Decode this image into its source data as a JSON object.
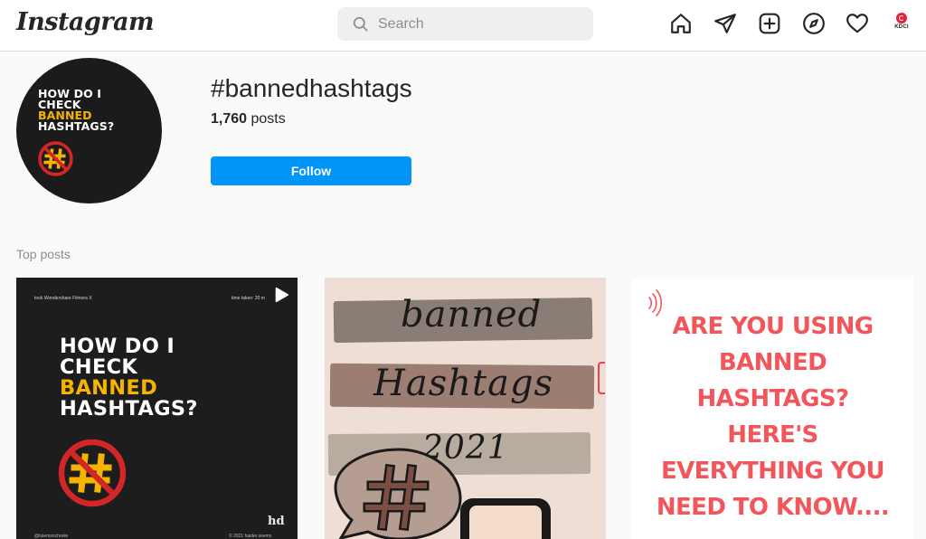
{
  "header": {
    "logo": "Instagram",
    "search_placeholder": "Search",
    "icons": [
      "home-icon",
      "direct-message-icon",
      "new-post-icon",
      "explore-icon",
      "activity-heart-icon"
    ],
    "profile_avatar_text": "KDCI"
  },
  "hashtag": {
    "title": "#bannedhashtags",
    "post_count": "1,760",
    "post_count_suffix": "posts",
    "follow_label": "Follow",
    "avatar_lines": [
      "HOW DO I",
      "CHECK",
      "BANNED",
      "HASHTAGS?"
    ]
  },
  "top_posts": {
    "label": "Top posts",
    "posts": [
      {
        "meta_left": "took Wondershare Filmora X",
        "meta_right": "time taken: 20 m",
        "lines": [
          "HOW DO I",
          "CHECK",
          "BANNED",
          "HASHTAGS?"
        ],
        "watermark": "hd",
        "footer_left": "@tulemsnchoole",
        "footer_right": "© 2021 haider.seems"
      },
      {
        "words": [
          "banned",
          "Hashtags",
          "2021"
        ]
      },
      {
        "lines": [
          "ARE YOU USING",
          "BANNED",
          "HASHTAGS?",
          "HERE'S",
          "EVERYTHING YOU",
          "NEED TO KNOW...."
        ],
        "dots": "••••••"
      }
    ]
  },
  "colors": {
    "follow_blue": "#0095f6",
    "highlight_yellow": "#f4b400",
    "post3_red": "#f2565a",
    "ban_red": "#d32626"
  }
}
